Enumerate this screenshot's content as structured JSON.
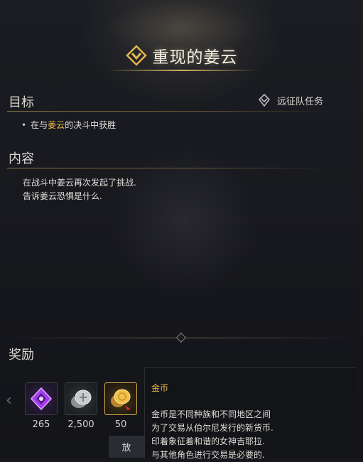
{
  "title": "重现的姜云",
  "objective": {
    "heading": "目标",
    "expedition_label": "远征队任务",
    "item_prefix": "在与",
    "item_highlight": "姜云",
    "item_suffix": "的决斗中获胜"
  },
  "content": {
    "heading": "内容",
    "lines": [
      "在战斗中姜云再次发起了挑战.",
      "告诉姜云恐惧是什么."
    ]
  },
  "rewards": {
    "heading": "奖励",
    "items": [
      {
        "icon": "purple-crystal-icon",
        "count": "265"
      },
      {
        "icon": "silver-coin-icon",
        "count": "2,500"
      },
      {
        "icon": "gold-coin-icon",
        "count": "50"
      }
    ]
  },
  "tooltip": {
    "title": "金币",
    "lines": [
      "金币是不同种族和不同地区之间",
      "为了交易从伯尔尼发行的新货币.",
      "印着象征着和谐的女神吉耶拉.",
      "与其他角色进行交易是必要的."
    ]
  },
  "action_button": "放",
  "colors": {
    "accent_gold": "#e6b94b",
    "background": "#15171c"
  }
}
